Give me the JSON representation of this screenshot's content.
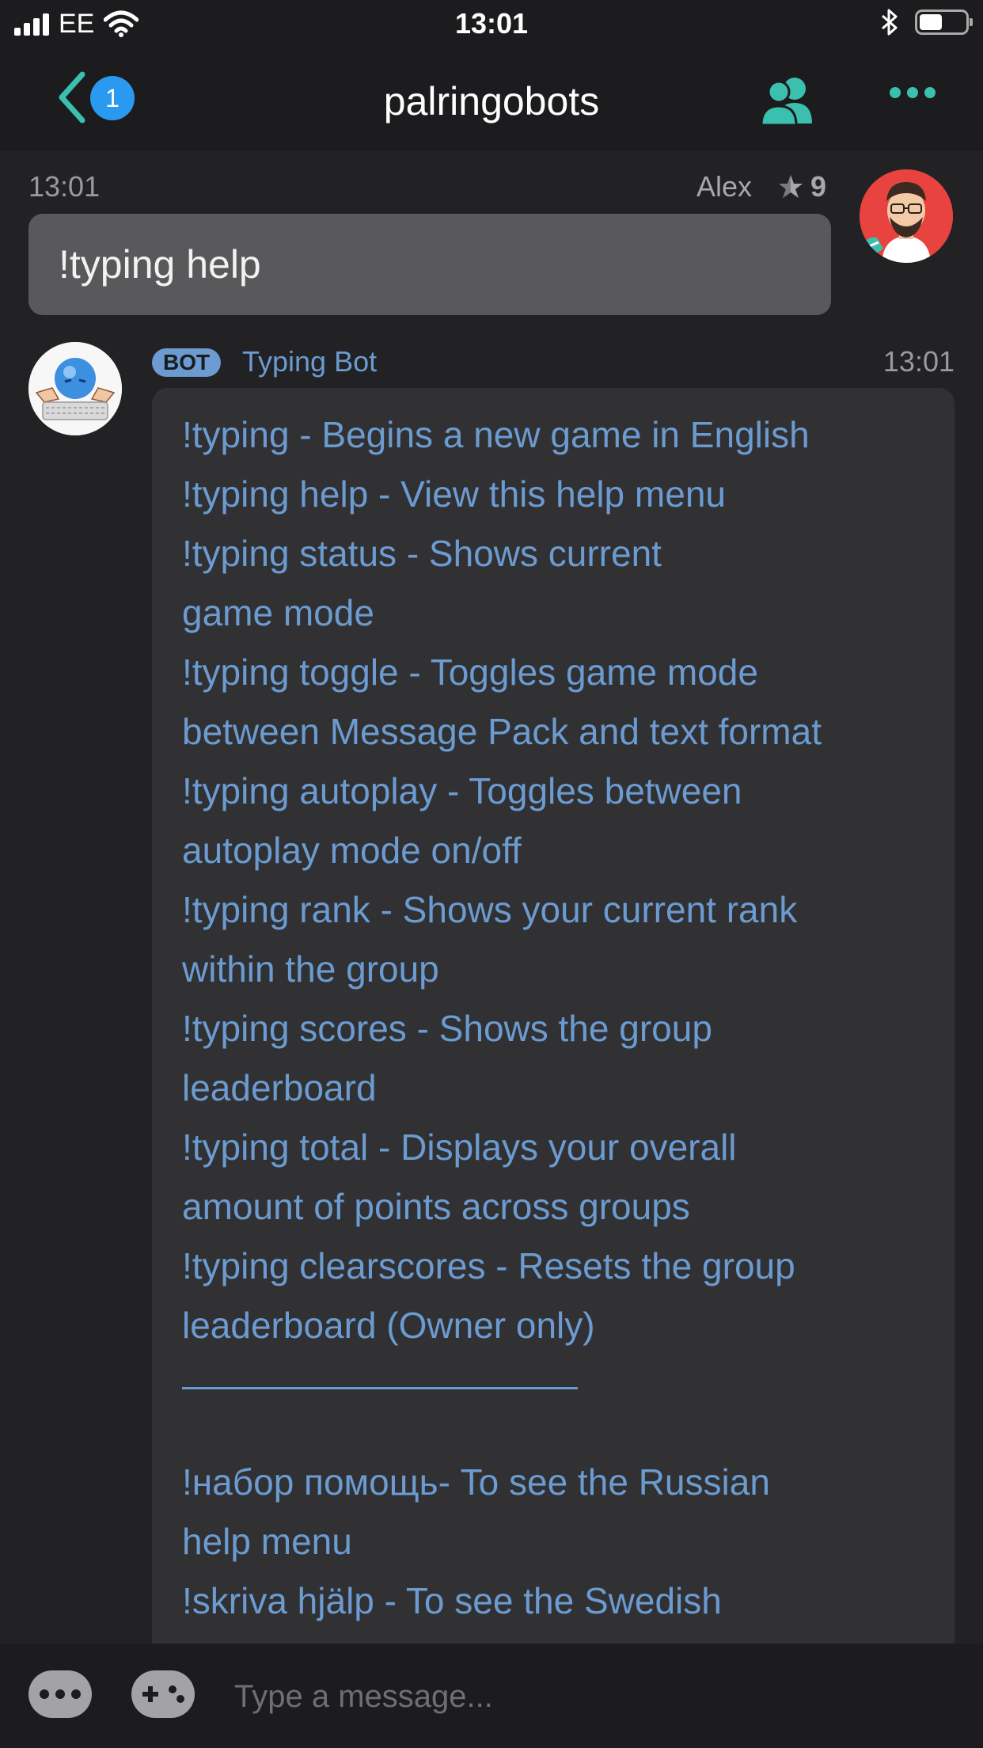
{
  "status_bar": {
    "carrier": "EE",
    "time": "13:01"
  },
  "nav": {
    "unread_count": "1",
    "title": "palringobots",
    "back_icon": "chevron-left-icon",
    "members_icon": "members-icon",
    "more_icon": "more-icon"
  },
  "messages": {
    "user_message": {
      "time": "13:01",
      "sender": "Alex",
      "reputation": "9",
      "text": "!typing help"
    },
    "bot_message": {
      "tag": "BOT",
      "sender": "Typing Bot",
      "time": "13:01",
      "lines": [
        "!typing - Begins a new game in English",
        "!typing help - View this help menu",
        "!typing status - Shows current",
        "game mode",
        "!typing toggle - Toggles game mode",
        "between Message Pack and text format",
        "!typing autoplay - Toggles between",
        "autoplay mode on/off",
        "!typing rank - Shows your current rank",
        "within the group",
        "!typing scores - Shows the group",
        "leaderboard",
        "!typing total - Displays your overall",
        "amount of points across groups",
        "!typing clearscores - Resets the group",
        "leaderboard (Owner only)"
      ],
      "lines_after_rule": [
        "!набор помощь- To see the Russian",
        "help menu",
        "!skriva hjälp - To see the Swedish"
      ]
    }
  },
  "input_bar": {
    "placeholder": "Type a message..."
  },
  "colors": {
    "accent": "#3bbfae",
    "badge": "#2a9af0",
    "bot_text": "#6b9bd0"
  }
}
